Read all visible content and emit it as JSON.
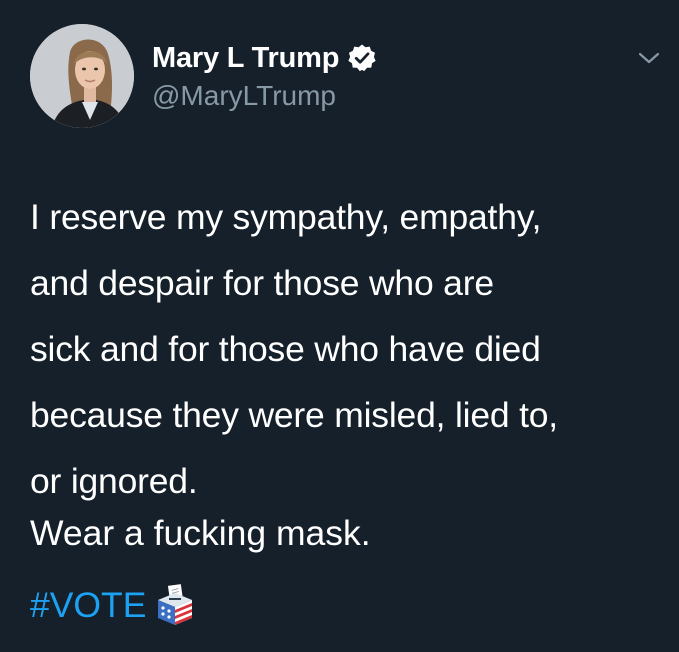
{
  "author": {
    "display_name": "Mary L Trump",
    "handle": "@MaryLTrump",
    "verified": true,
    "avatar_icon": "profile-photo"
  },
  "header": {
    "menu_icon": "chevron-down-icon"
  },
  "tweet": {
    "lines": [
      "I reserve my sympathy, empathy,",
      "and despair for those who are",
      "sick and for those who have died",
      "because they were misled, lied to,",
      "or ignored."
    ],
    "paragraph2": "Wear a fucking mask.",
    "hashtag": "#VOTE",
    "hashtag_icon": "ballot-box-icon"
  },
  "colors": {
    "background": "#15202b",
    "text": "#ffffff",
    "secondary_text": "#8899a6",
    "link": "#1da1f2"
  }
}
